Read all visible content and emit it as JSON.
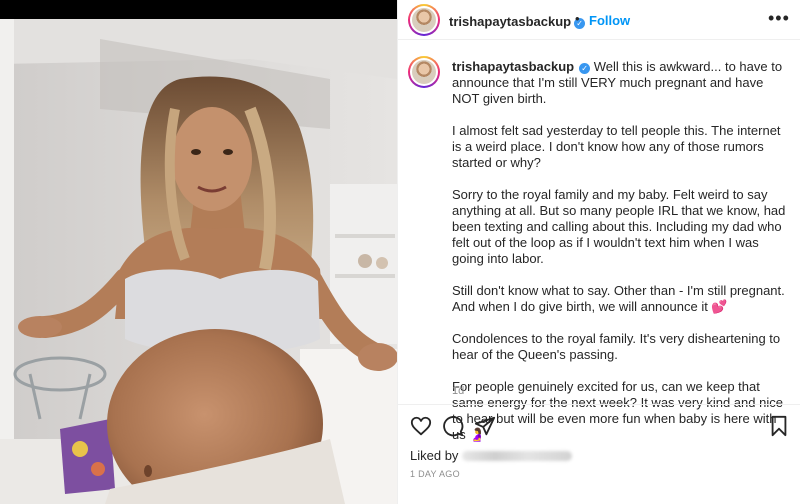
{
  "post": {
    "username": "trishapaytasbackup",
    "verified_glyph": "✓",
    "separator": "•",
    "follow_label": "Follow",
    "more_glyph": "•••",
    "caption_first": "Well this is awkward... to have to announce that I'm still VERY much pregnant and have NOT given birth.",
    "caption_paragraphs": [
      "I almost felt sad yesterday to tell people this. The internet is a weird place. I don't know how any of those rumors started or why?",
      "Sorry to the royal family and my baby. Felt weird to say anything at all. But so many people IRL that we know, had been texting and calling about this. Including my dad who felt out of the loop as if I wouldn't text him when I was going into labor.",
      "Still don't know what to say. Other than - I'm still pregnant. And when I do give birth, we will announce it 💕",
      "Condolences to the royal family. It's very disheartening to hear of the Queen's passing.",
      "For people genuinely excited for us, can we keep that same energy for the next week? It was very kind and nice to hear but will be even more fun when baby is here with us 🤰"
    ],
    "time_ago": "1d",
    "likes_prefix": "Liked by",
    "date": "1 DAY AGO"
  },
  "icons": {
    "like": "heart-icon",
    "comment": "comment-icon",
    "share": "paper-plane-icon",
    "save": "bookmark-icon"
  },
  "colors": {
    "link_blue": "#0095f6",
    "text": "#262626",
    "muted": "#8e8e8e"
  }
}
